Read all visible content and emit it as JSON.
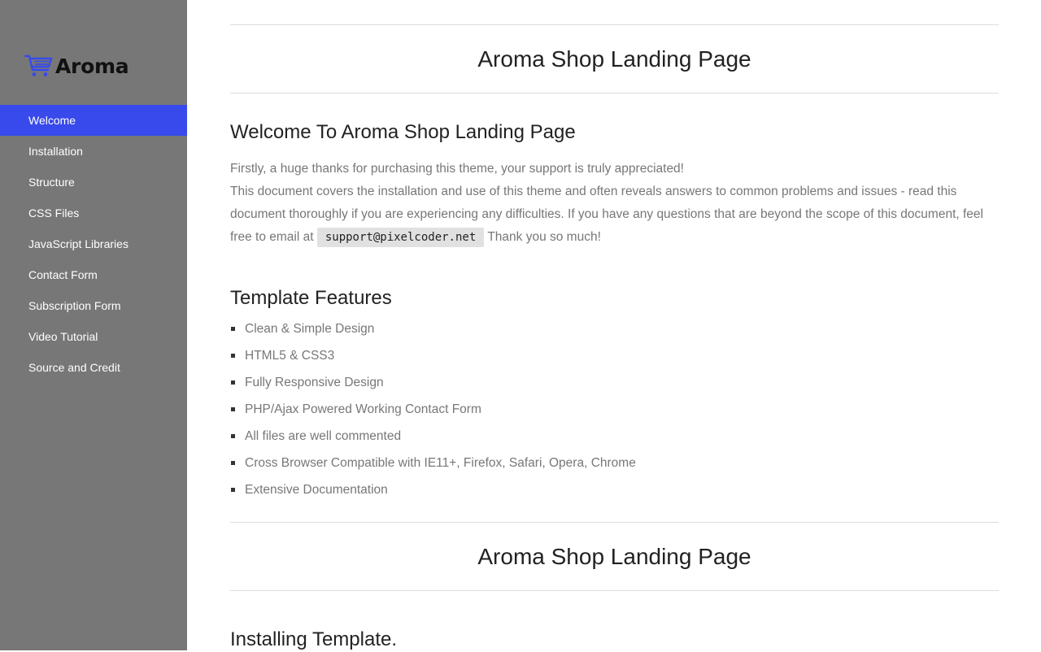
{
  "brand": {
    "name": "Aroma",
    "accent": "#384aeb",
    "icon": "shopping-cart-icon"
  },
  "sidebar": {
    "background": "#777777",
    "items": [
      {
        "label": "Welcome",
        "active": true
      },
      {
        "label": "Installation"
      },
      {
        "label": "Structure"
      },
      {
        "label": "CSS Files"
      },
      {
        "label": "JavaScript Libraries"
      },
      {
        "label": "Contact Form"
      },
      {
        "label": "Subscription Form"
      },
      {
        "label": "Video Tutorial"
      },
      {
        "label": "Source and Credit"
      }
    ]
  },
  "main": {
    "section1_title": "Aroma Shop Landing Page",
    "welcome_heading": "Welcome To Aroma Shop Landing Page",
    "intro_line1": "Firstly, a huge thanks for purchasing this theme, your support is truly appreciated!",
    "intro_line2": "This document covers the installation and use of this theme and often reveals answers to common problems and issues - read this document thoroughly if you are experiencing any difficulties. If you have any questions that are beyond the scope of this document, feel free to email at",
    "email": "support@pixelcoder.net",
    "intro_thanks": "Thank you so much!",
    "features_heading": "Template Features",
    "features": [
      "Clean & Simple Design",
      "HTML5 & CSS3",
      "Fully Responsive Design",
      "PHP/Ajax Powered Working Contact Form",
      "All files are well commented",
      "Cross Browser Compatible with IE11+, Firefox, Safari, Opera, Chrome",
      "Extensive Documentation"
    ],
    "section2_title": "Aroma Shop Landing Page",
    "install_heading": "Installing Template."
  }
}
